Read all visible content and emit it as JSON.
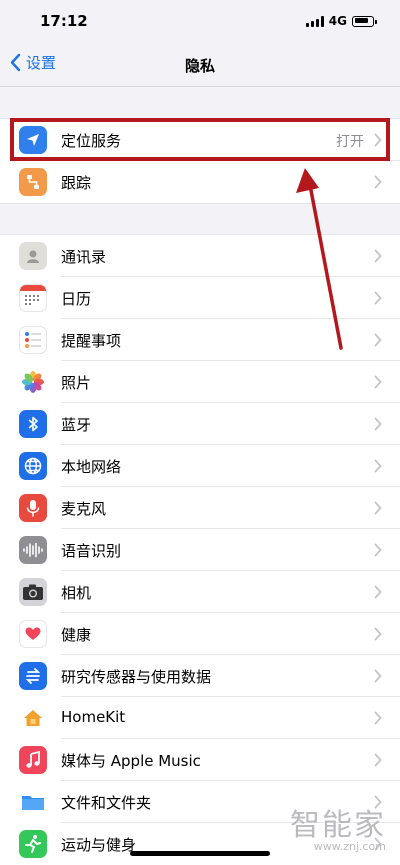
{
  "status": {
    "time": "17:12",
    "network": "4G"
  },
  "nav": {
    "back_label": "设置",
    "title": "隐私"
  },
  "group1": [
    {
      "label": "定位服务",
      "value": "打开",
      "icon": "location-arrow-icon",
      "color": "#2f80ed"
    },
    {
      "label": "跟踪",
      "value": "",
      "icon": "tracking-icon",
      "color": "#f2994a"
    }
  ],
  "group2": [
    {
      "label": "通讯录",
      "icon": "contacts-icon",
      "color": "#d9d9d9"
    },
    {
      "label": "日历",
      "icon": "calendar-icon",
      "color": "#ffffff"
    },
    {
      "label": "提醒事项",
      "icon": "reminders-icon",
      "color": "#ffffff"
    },
    {
      "label": "照片",
      "icon": "photos-icon",
      "color": "#ffffff"
    },
    {
      "label": "蓝牙",
      "icon": "bluetooth-icon",
      "color": "#1e6fe8"
    },
    {
      "label": "本地网络",
      "icon": "globe-icon",
      "color": "#1e6fe8"
    },
    {
      "label": "麦克风",
      "icon": "microphone-icon",
      "color": "#e84a3f"
    },
    {
      "label": "语音识别",
      "icon": "waveform-icon",
      "color": "#8e8e93"
    },
    {
      "label": "相机",
      "icon": "camera-icon",
      "color": "#8e8e93"
    },
    {
      "label": "健康",
      "icon": "heart-icon",
      "color": "#ffffff"
    },
    {
      "label": "研究传感器与使用数据",
      "icon": "research-icon",
      "color": "#1e6fe8"
    },
    {
      "label": "HomeKit",
      "icon": "home-icon",
      "color": "#ffffff"
    },
    {
      "label": "媒体与 Apple Music",
      "icon": "music-icon",
      "color": "#f0455a"
    },
    {
      "label": "文件和文件夹",
      "icon": "folder-icon",
      "color": "#ffffff"
    },
    {
      "label": "运动与健身",
      "icon": "fitness-icon",
      "color": "#34c759"
    }
  ],
  "watermark": {
    "brand": "智能家",
    "url": "www.znj.com"
  },
  "colors": {
    "accent": "#1a73e8",
    "annotation": "#b3181c"
  }
}
